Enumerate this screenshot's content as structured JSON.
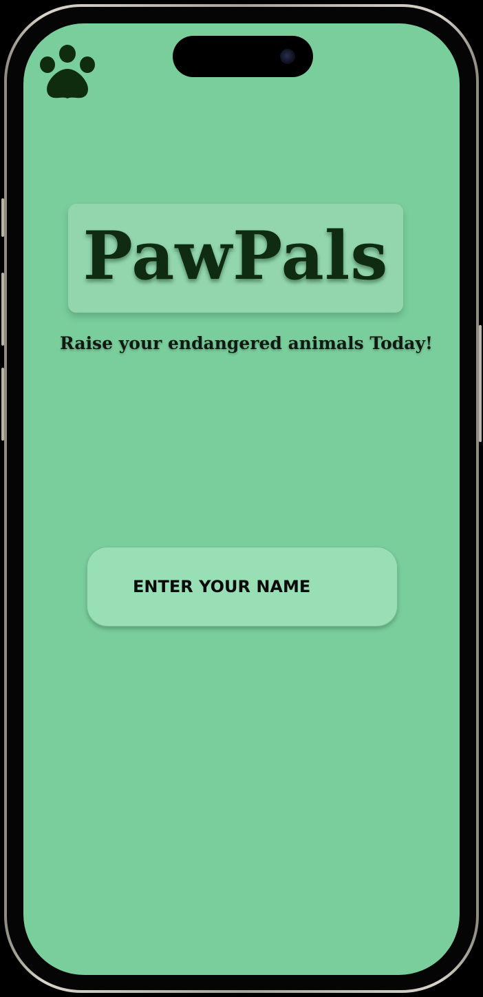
{
  "app": {
    "title": "PawPals",
    "tagline": "Raise your endangered animals Today!",
    "logo_icon": "paw-icon"
  },
  "name_entry": {
    "placeholder": "ENTER YOUR NAME",
    "value": ""
  },
  "colors": {
    "screen_background": "#7ace9c",
    "title_text": "#0f2c12",
    "input_background": "#98dfb6"
  }
}
